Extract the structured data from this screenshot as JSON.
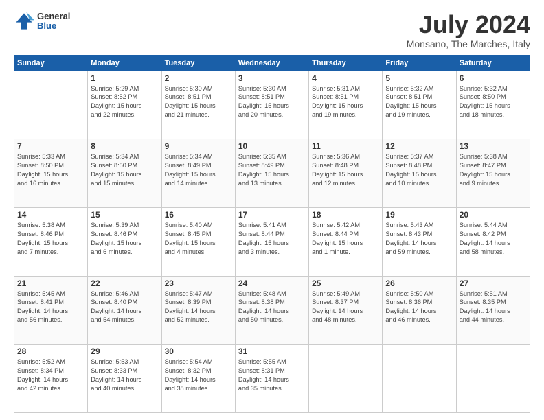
{
  "header": {
    "logo": {
      "general": "General",
      "blue": "Blue"
    },
    "title": "July 2024",
    "location": "Monsano, The Marches, Italy"
  },
  "calendar": {
    "days_of_week": [
      "Sunday",
      "Monday",
      "Tuesday",
      "Wednesday",
      "Thursday",
      "Friday",
      "Saturday"
    ],
    "weeks": [
      [
        {
          "day": "",
          "info": ""
        },
        {
          "day": "1",
          "info": "Sunrise: 5:29 AM\nSunset: 8:52 PM\nDaylight: 15 hours\nand 22 minutes."
        },
        {
          "day": "2",
          "info": "Sunrise: 5:30 AM\nSunset: 8:51 PM\nDaylight: 15 hours\nand 21 minutes."
        },
        {
          "day": "3",
          "info": "Sunrise: 5:30 AM\nSunset: 8:51 PM\nDaylight: 15 hours\nand 20 minutes."
        },
        {
          "day": "4",
          "info": "Sunrise: 5:31 AM\nSunset: 8:51 PM\nDaylight: 15 hours\nand 19 minutes."
        },
        {
          "day": "5",
          "info": "Sunrise: 5:32 AM\nSunset: 8:51 PM\nDaylight: 15 hours\nand 19 minutes."
        },
        {
          "day": "6",
          "info": "Sunrise: 5:32 AM\nSunset: 8:50 PM\nDaylight: 15 hours\nand 18 minutes."
        }
      ],
      [
        {
          "day": "7",
          "info": "Sunrise: 5:33 AM\nSunset: 8:50 PM\nDaylight: 15 hours\nand 16 minutes."
        },
        {
          "day": "8",
          "info": "Sunrise: 5:34 AM\nSunset: 8:50 PM\nDaylight: 15 hours\nand 15 minutes."
        },
        {
          "day": "9",
          "info": "Sunrise: 5:34 AM\nSunset: 8:49 PM\nDaylight: 15 hours\nand 14 minutes."
        },
        {
          "day": "10",
          "info": "Sunrise: 5:35 AM\nSunset: 8:49 PM\nDaylight: 15 hours\nand 13 minutes."
        },
        {
          "day": "11",
          "info": "Sunrise: 5:36 AM\nSunset: 8:48 PM\nDaylight: 15 hours\nand 12 minutes."
        },
        {
          "day": "12",
          "info": "Sunrise: 5:37 AM\nSunset: 8:48 PM\nDaylight: 15 hours\nand 10 minutes."
        },
        {
          "day": "13",
          "info": "Sunrise: 5:38 AM\nSunset: 8:47 PM\nDaylight: 15 hours\nand 9 minutes."
        }
      ],
      [
        {
          "day": "14",
          "info": "Sunrise: 5:38 AM\nSunset: 8:46 PM\nDaylight: 15 hours\nand 7 minutes."
        },
        {
          "day": "15",
          "info": "Sunrise: 5:39 AM\nSunset: 8:46 PM\nDaylight: 15 hours\nand 6 minutes."
        },
        {
          "day": "16",
          "info": "Sunrise: 5:40 AM\nSunset: 8:45 PM\nDaylight: 15 hours\nand 4 minutes."
        },
        {
          "day": "17",
          "info": "Sunrise: 5:41 AM\nSunset: 8:44 PM\nDaylight: 15 hours\nand 3 minutes."
        },
        {
          "day": "18",
          "info": "Sunrise: 5:42 AM\nSunset: 8:44 PM\nDaylight: 15 hours\nand 1 minute."
        },
        {
          "day": "19",
          "info": "Sunrise: 5:43 AM\nSunset: 8:43 PM\nDaylight: 14 hours\nand 59 minutes."
        },
        {
          "day": "20",
          "info": "Sunrise: 5:44 AM\nSunset: 8:42 PM\nDaylight: 14 hours\nand 58 minutes."
        }
      ],
      [
        {
          "day": "21",
          "info": "Sunrise: 5:45 AM\nSunset: 8:41 PM\nDaylight: 14 hours\nand 56 minutes."
        },
        {
          "day": "22",
          "info": "Sunrise: 5:46 AM\nSunset: 8:40 PM\nDaylight: 14 hours\nand 54 minutes."
        },
        {
          "day": "23",
          "info": "Sunrise: 5:47 AM\nSunset: 8:39 PM\nDaylight: 14 hours\nand 52 minutes."
        },
        {
          "day": "24",
          "info": "Sunrise: 5:48 AM\nSunset: 8:38 PM\nDaylight: 14 hours\nand 50 minutes."
        },
        {
          "day": "25",
          "info": "Sunrise: 5:49 AM\nSunset: 8:37 PM\nDaylight: 14 hours\nand 48 minutes."
        },
        {
          "day": "26",
          "info": "Sunrise: 5:50 AM\nSunset: 8:36 PM\nDaylight: 14 hours\nand 46 minutes."
        },
        {
          "day": "27",
          "info": "Sunrise: 5:51 AM\nSunset: 8:35 PM\nDaylight: 14 hours\nand 44 minutes."
        }
      ],
      [
        {
          "day": "28",
          "info": "Sunrise: 5:52 AM\nSunset: 8:34 PM\nDaylight: 14 hours\nand 42 minutes."
        },
        {
          "day": "29",
          "info": "Sunrise: 5:53 AM\nSunset: 8:33 PM\nDaylight: 14 hours\nand 40 minutes."
        },
        {
          "day": "30",
          "info": "Sunrise: 5:54 AM\nSunset: 8:32 PM\nDaylight: 14 hours\nand 38 minutes."
        },
        {
          "day": "31",
          "info": "Sunrise: 5:55 AM\nSunset: 8:31 PM\nDaylight: 14 hours\nand 35 minutes."
        },
        {
          "day": "",
          "info": ""
        },
        {
          "day": "",
          "info": ""
        },
        {
          "day": "",
          "info": ""
        }
      ]
    ]
  }
}
